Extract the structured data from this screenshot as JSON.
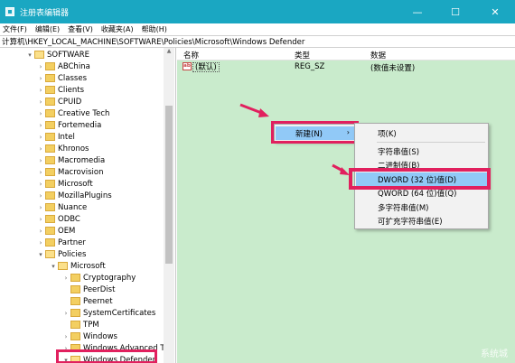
{
  "window": {
    "title": "注册表编辑器",
    "minimize": "—",
    "maximize": "☐",
    "close": "✕"
  },
  "menubar": [
    "文件(F)",
    "编辑(E)",
    "查看(V)",
    "收藏夹(A)",
    "帮助(H)"
  ],
  "address": "计算机\\HKEY_LOCAL_MACHINE\\SOFTWARE\\Policies\\Microsoft\\Windows Defender",
  "tree": {
    "root": "SOFTWARE",
    "items": [
      "ABChina",
      "Classes",
      "Clients",
      "CPUID",
      "Creative Tech",
      "Fortemedia",
      "Intel",
      "Khronos",
      "Macromedia",
      "Macrovision",
      "Microsoft",
      "MozillaPlugins",
      "Nuance",
      "ODBC",
      "OEM",
      "Partner",
      "Policies"
    ],
    "policies_child": "Microsoft",
    "microsoft_children": [
      "Cryptography",
      "PeerDist",
      "Peernet",
      "SystemCertificates",
      "TPM",
      "Windows",
      "Windows Advanced Th",
      "Windows Defender"
    ]
  },
  "values_header": {
    "name": "名称",
    "type": "类型",
    "data": "数据"
  },
  "values_rows": [
    {
      "icon": "ab",
      "name": "(默认)",
      "type": "REG_SZ",
      "data": "(数值未设置)"
    }
  ],
  "context_menu": {
    "new_label": "新建(N)",
    "arrow": "›",
    "submenu": {
      "key": "项(K)",
      "string": "字符串值(S)",
      "binary": "二进制值(B)",
      "dword": "DWORD (32 位)值(D)",
      "qword": "QWORD (64 位)值(Q)",
      "multi": "多字符串值(M)",
      "expand": "可扩充字符串值(E)"
    }
  },
  "watermark": "系统城",
  "colors": {
    "titlebar": "#1aa7c2",
    "values_bg": "#c9ebcc",
    "highlight_box": "#e1205e",
    "menu_selected": "#91c9f7",
    "folder": "#f3cf61"
  }
}
